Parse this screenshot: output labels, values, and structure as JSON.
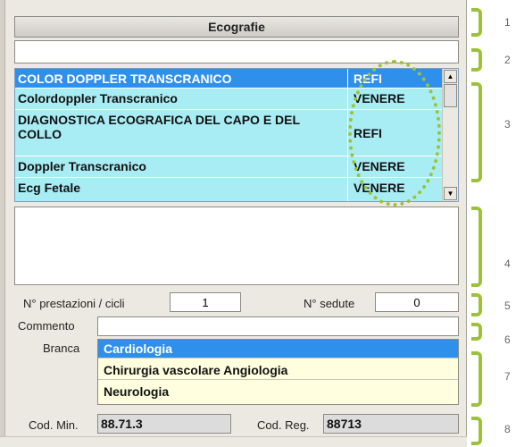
{
  "header": {
    "title": "Ecografie"
  },
  "search": {
    "value": ""
  },
  "exams": [
    {
      "name": "COLOR DOPPLER TRANSCRANICO",
      "lab": "REFI",
      "selected": true
    },
    {
      "name": "Colordoppler Transcranico",
      "lab": "VENERE"
    },
    {
      "name": "DIAGNOSTICA ECOGRAFICA DEL CAPO E DEL COLLO",
      "lab": "REFI"
    },
    {
      "name": "Doppler Transcranico",
      "lab": "VENERE"
    },
    {
      "name": "Ecg Fetale",
      "lab": "VENERE"
    }
  ],
  "scrollbar": {
    "up_icon": "triangle-up",
    "down_icon": "triangle-down"
  },
  "notes": {
    "value": ""
  },
  "counts": {
    "prestazioni_label": "N° prestazioni / cicli",
    "prestazioni_value": "1",
    "sedute_label": "N° sedute",
    "sedute_value": "0"
  },
  "comment": {
    "label": "Commento",
    "value": ""
  },
  "branch": {
    "label": "Branca",
    "options": [
      "Cardiologia",
      "Chirurgia vascolare Angiologia",
      "Neurologia"
    ],
    "selected": "Cardiologia"
  },
  "codes": {
    "min_label": "Cod. Min.",
    "min_value": "88.71.3",
    "reg_label": "Cod. Reg.",
    "reg_value": "88713"
  },
  "callouts": [
    "1",
    "2",
    "3",
    "4",
    "5",
    "6",
    "7",
    "8"
  ],
  "colors": {
    "selection": "#2f90ec",
    "list_bg": "#a8ecf4",
    "branch_bg": "#ffffe0",
    "annotation": "#9cc23a"
  }
}
